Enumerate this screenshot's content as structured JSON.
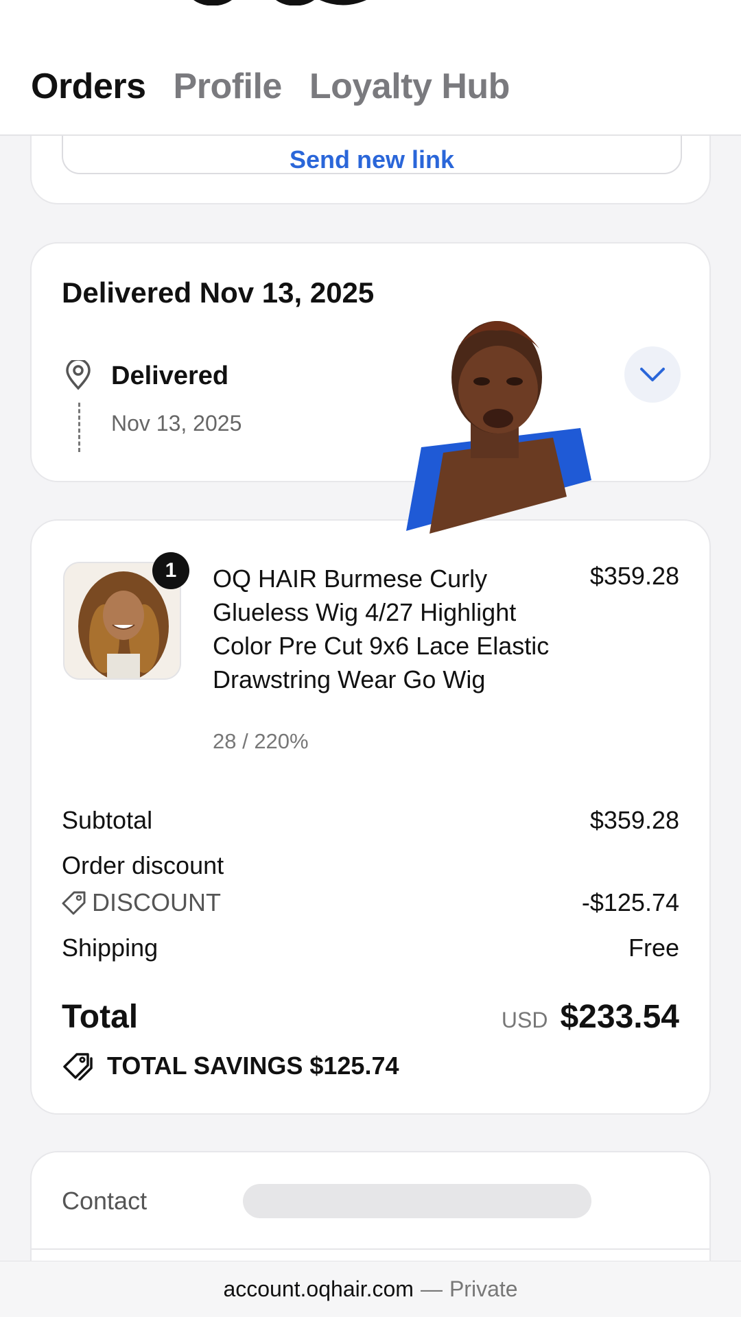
{
  "header": {
    "tabs": [
      {
        "label": "Orders",
        "active": true
      },
      {
        "label": "Profile",
        "active": false
      },
      {
        "label": "Loyalty Hub",
        "active": false
      }
    ]
  },
  "top_card": {
    "link_label": "Send new link"
  },
  "delivery": {
    "title": "Delivered Nov 13, 2025",
    "status": "Delivered",
    "date": "Nov 13, 2025"
  },
  "order": {
    "item": {
      "quantity": "1",
      "name": "OQ HAIR Burmese Curly Glueless Wig 4/27 Highlight Color Pre Cut 9x6 Lace Elastic Drawstring Wear Go Wig",
      "variant": "28 / 220%",
      "price": "$359.28"
    },
    "subtotal_label": "Subtotal",
    "subtotal_value": "$359.28",
    "discount_label": "Order discount",
    "discount_code": "DISCOUNT",
    "discount_value": "-$125.74",
    "shipping_label": "Shipping",
    "shipping_value": "Free",
    "total_label": "Total",
    "currency": "USD",
    "total_value": "$233.54",
    "savings": "TOTAL SAVINGS $125.74"
  },
  "contact": {
    "label": "Contact"
  },
  "address_bar": {
    "domain": "account.oqhair.com",
    "separator": "—",
    "mode": "Private"
  },
  "colors": {
    "accent": "#2a66d9",
    "text": "#111111",
    "muted": "#777777"
  }
}
